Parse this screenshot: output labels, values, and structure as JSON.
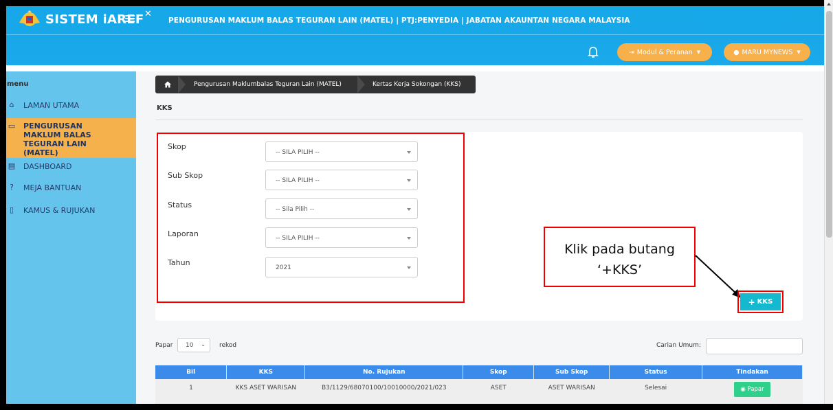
{
  "app": {
    "brand": "SISTEM iAREF",
    "header_title": "PENGURUSAN MAKLUM BALAS TEGURAN LAIN (MATEL) | PTJ:PENYEDIA | JABATAN AKAUNTAN NEGARA MALAYSIA",
    "modul_label": "Modul & Peranan",
    "user_label": "MARU MYNEWS"
  },
  "sidebar": {
    "title": "menu",
    "items": [
      {
        "label": "LAMAN UTAMA",
        "icon": "home-icon"
      },
      {
        "label": "PENGURUSAN MAKLUM BALAS TEGURAN LAIN (MATEL)",
        "icon": "window-icon"
      },
      {
        "label": "DASHBOARD",
        "icon": "dashboard-icon"
      },
      {
        "label": "MEJA BANTUAN",
        "icon": "help-icon"
      },
      {
        "label": "KAMUS & RUJUKAN",
        "icon": "book-icon"
      }
    ]
  },
  "breadcrumb": {
    "seg1": "Pengurusan Maklumbalas Teguran Lain (MATEL)",
    "seg2": "Kertas Kerja Sokongan (KKS)"
  },
  "page": {
    "title": "KKS"
  },
  "form": {
    "fields": [
      {
        "label": "Skop",
        "value": "-- SILA PILIH --"
      },
      {
        "label": "Sub Skop",
        "value": "-- SILA PILIH --"
      },
      {
        "label": "Status",
        "value": "-- Sila Pilih --"
      },
      {
        "label": "Laporan",
        "value": "-- SILA PILIH --"
      },
      {
        "label": "Tahun",
        "value": "2021"
      }
    ]
  },
  "annotation": {
    "line1": "Klik pada butang",
    "line2": "‘+KKS’"
  },
  "add_button": {
    "label": "KKS"
  },
  "listing": {
    "show_label": "Papar",
    "show_value": "10",
    "records_label": "rekod",
    "search_label": "Carian Umum:"
  },
  "table": {
    "headers": [
      "Bil",
      "KKS",
      "No. Rujukan",
      "Skop",
      "Sub Skop",
      "Status",
      "Tindakan"
    ],
    "rows": [
      [
        "1",
        "KKS ASET WARISAN",
        "B3/1129/68070100/10010000/2021/023",
        "ASET",
        "ASET WARISAN",
        "Selesai",
        "Papar"
      ]
    ]
  },
  "colors": {
    "header_blue": "#16a7e8",
    "sidebar_blue": "#65c4ec",
    "accent_orange": "#f5b24c",
    "table_header": "#3b8beb",
    "kks_button": "#15b9cf",
    "papar_button": "#2fd18a"
  }
}
